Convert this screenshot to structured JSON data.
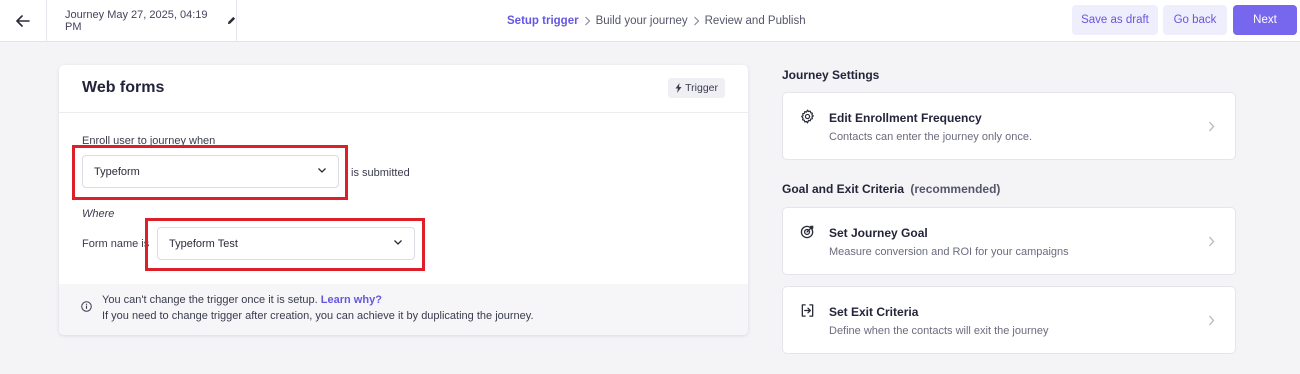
{
  "header": {
    "journey_title": "Journey May 27, 2025, 04:19 PM",
    "steps": [
      "Setup trigger",
      "Build your journey",
      "Review and Publish"
    ],
    "active_step": 0,
    "save_draft": "Save as draft",
    "go_back": "Go back",
    "next": "Next"
  },
  "trigger_card": {
    "title": "Web forms",
    "badge": "Trigger",
    "enroll_label": "Enroll user to journey when",
    "form_select_value": "Typeform",
    "submitted_text": "is submitted",
    "where_label": "Where",
    "form_name_label": "Form name is",
    "form_name_value": "Typeform Test",
    "notice_line1": "You can't change the trigger once it is setup.",
    "notice_link": "Learn why?",
    "notice_line2": "If you need to change trigger after creation, you can achieve it by duplicating the journey."
  },
  "settings": {
    "journey_settings_title": "Journey Settings",
    "enrollment": {
      "title": "Edit Enrollment Frequency",
      "desc": "Contacts can enter the journey only once.",
      "icon": "gear-icon"
    },
    "goal_exit_title": "Goal and Exit Criteria",
    "goal_exit_suffix": "(recommended)",
    "goal": {
      "title": "Set Journey Goal",
      "desc": "Measure conversion and ROI for your campaigns",
      "icon": "target-icon"
    },
    "exit": {
      "title": "Set Exit Criteria",
      "desc": "Define when the contacts will exit the journey",
      "icon": "exit-icon"
    }
  },
  "colors": {
    "accent": "#6457e0",
    "primary_button": "#7766ee",
    "highlight": "#dd1f2a"
  }
}
